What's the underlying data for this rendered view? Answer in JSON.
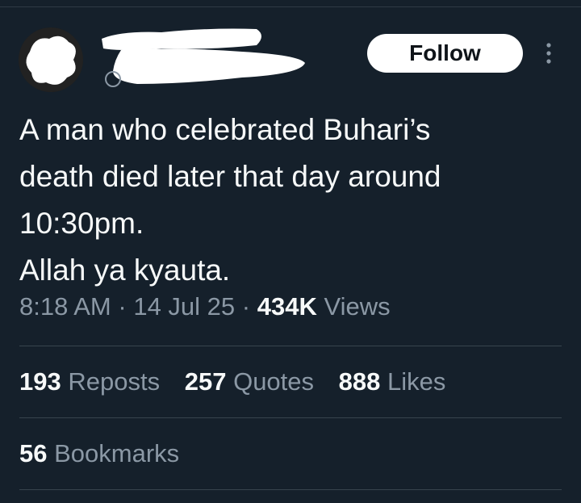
{
  "follow_button": {
    "label": "Follow"
  },
  "tweet": {
    "lines": [
      "A man who celebrated Buhari’s",
      "death died later that day around",
      "10:30pm.",
      "Allah ya kyauta."
    ]
  },
  "meta": {
    "time": "8:18 AM",
    "separator": "·",
    "date": "14 Jul 25",
    "views_count": "434K",
    "views_label": "Views"
  },
  "stats": {
    "reposts_count": "193",
    "reposts_label": "Reposts",
    "quotes_count": "257",
    "quotes_label": "Quotes",
    "likes_count": "888",
    "likes_label": "Likes",
    "bookmarks_count": "56",
    "bookmarks_label": "Bookmarks"
  },
  "icons": {
    "avatar": "avatar",
    "more": "more-vertical-icon"
  },
  "colors": {
    "background": "#15202b",
    "text_primary": "#f7f9f9",
    "text_secondary": "#8b98a5",
    "divider": "#38444d",
    "follow_bg": "#ffffff",
    "follow_text": "#0f1419"
  }
}
